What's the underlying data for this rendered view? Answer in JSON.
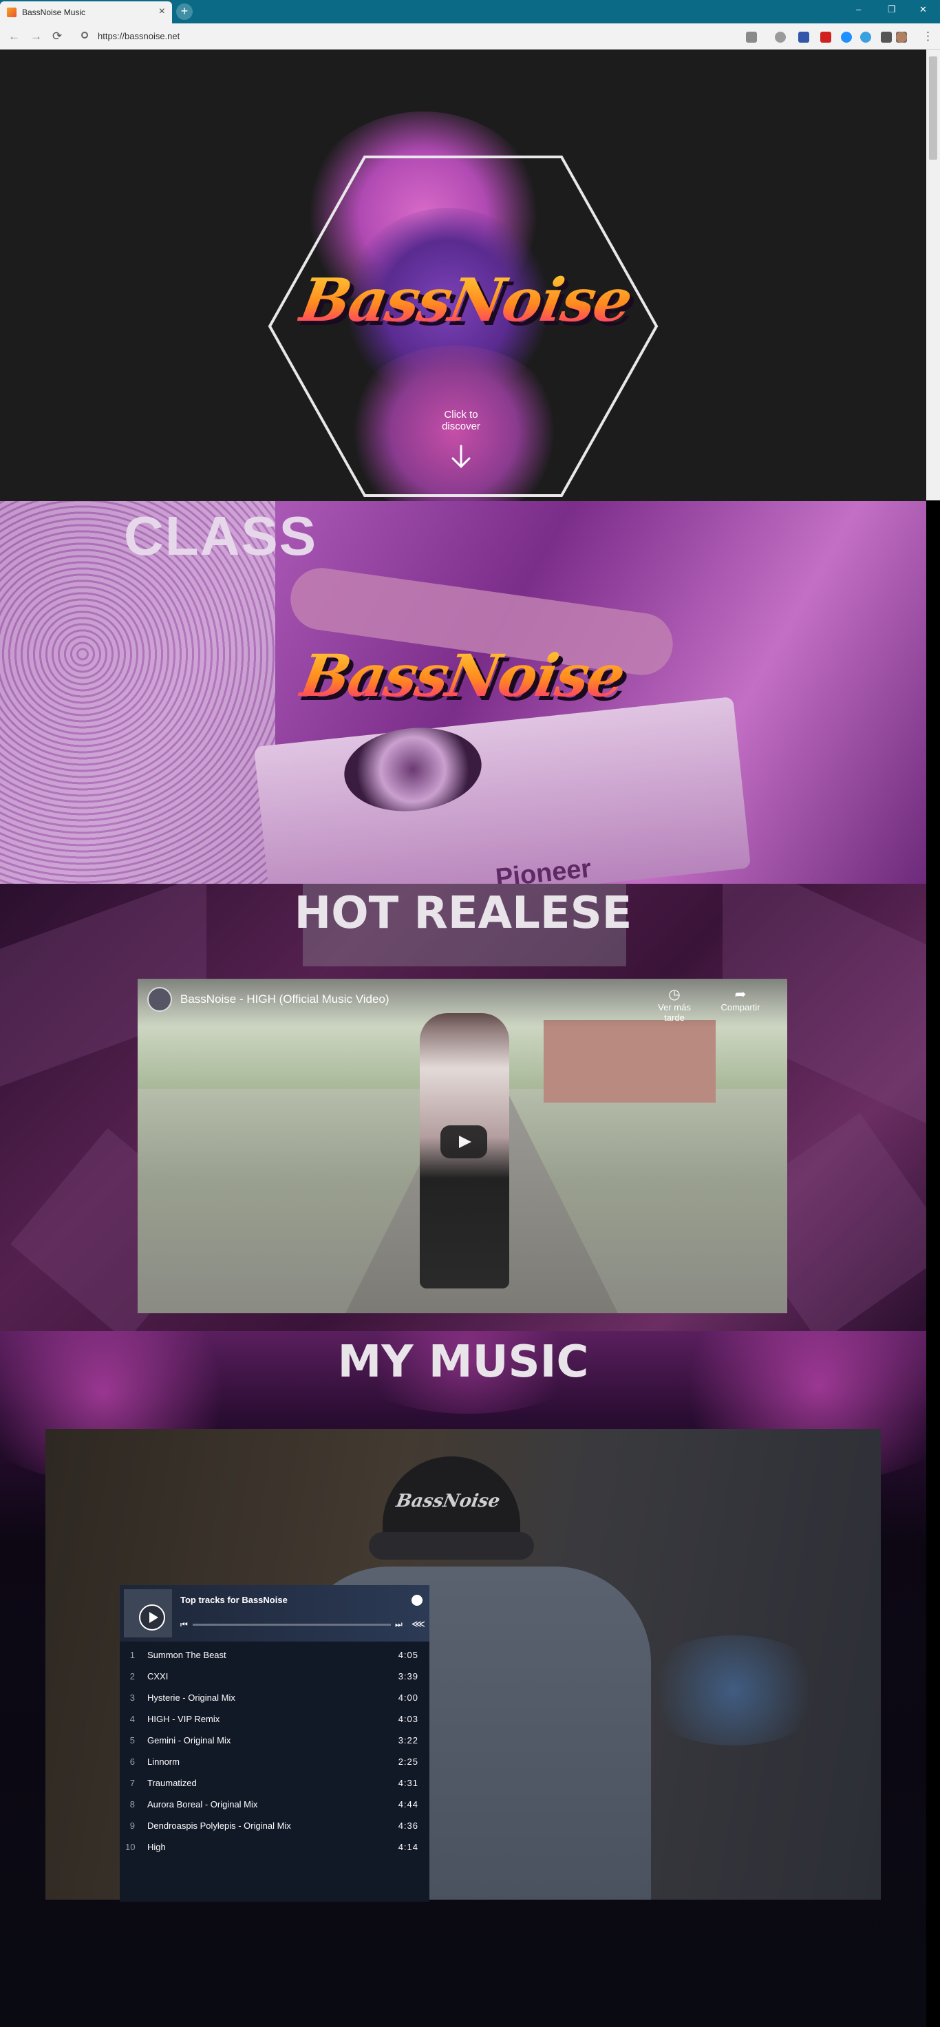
{
  "browser": {
    "tab_title": "BassNoise Music",
    "tab_close": "×",
    "new_tab": "+",
    "url": "https://bassnoise.net",
    "win_minimize": "–",
    "win_restore": "❐",
    "win_close": "✕",
    "back": "←",
    "forward": "→",
    "reload": "⟳",
    "menu": "⋮"
  },
  "hero": {
    "logo": "BassNoise",
    "discover_line1": "Click to",
    "discover_line2": "discover"
  },
  "dj": {
    "logo": "BassNoise",
    "shirt_text": "CLASS",
    "brand": "Pioneer"
  },
  "hot_release": {
    "title": "HOT REALESE",
    "video": {
      "title": "BassNoise - HIGH (Official Music Video)",
      "watch_later": "Ver más tarde",
      "share": "Compartir"
    }
  },
  "my_music": {
    "title": "MY MUSIC",
    "cap_logo": "BassNoise",
    "player": {
      "heading": "Top tracks for BassNoise",
      "tracks": [
        {
          "num": "1",
          "name": "Summon The Beast",
          "duration": "4:05"
        },
        {
          "num": "2",
          "name": "CXXI",
          "duration": "3:39"
        },
        {
          "num": "3",
          "name": "Hysterie - Original Mix",
          "duration": "4:00"
        },
        {
          "num": "4",
          "name": "HIGH - VIP Remix",
          "duration": "4:03"
        },
        {
          "num": "5",
          "name": "Gemini - Original Mix",
          "duration": "3:22"
        },
        {
          "num": "6",
          "name": "Linnorm",
          "duration": "2:25"
        },
        {
          "num": "7",
          "name": "Traumatized",
          "duration": "4:31"
        },
        {
          "num": "8",
          "name": "Aurora Boreal - Original Mix",
          "duration": "4:44"
        },
        {
          "num": "9",
          "name": "Dendroaspis Polylepis - Original Mix",
          "duration": "4:36"
        },
        {
          "num": "10",
          "name": "High",
          "duration": "4:14"
        }
      ]
    }
  }
}
